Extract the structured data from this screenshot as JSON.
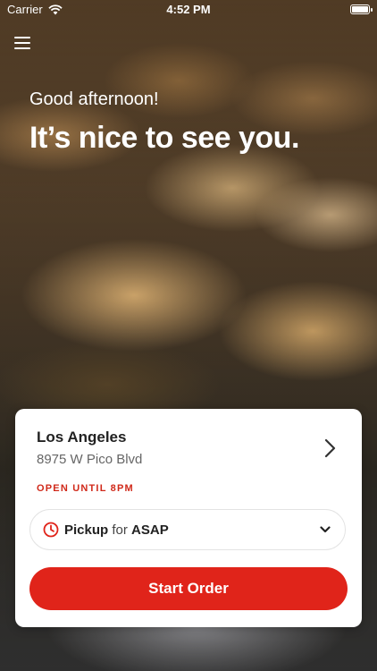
{
  "status_bar": {
    "carrier": "Carrier",
    "time": "4:52 PM"
  },
  "icons": {
    "menu": "menu-icon",
    "wifi": "wifi-icon",
    "battery": "battery-icon",
    "chevron_right": "chevron-right-icon",
    "clock": "clock-icon",
    "chevron_down": "chevron-down-icon"
  },
  "hero": {
    "greeting": "Good afternoon!",
    "headline": "It’s nice to see you."
  },
  "location": {
    "name": "Los Angeles",
    "address": "8975 W Pico Blvd",
    "status": "OPEN UNTIL 8PM"
  },
  "order": {
    "mode": "Pickup",
    "connector": "for",
    "time": "ASAP",
    "start_label": "Start Order"
  },
  "colors": {
    "accent": "#e0241a",
    "status_red": "#d0291a"
  }
}
